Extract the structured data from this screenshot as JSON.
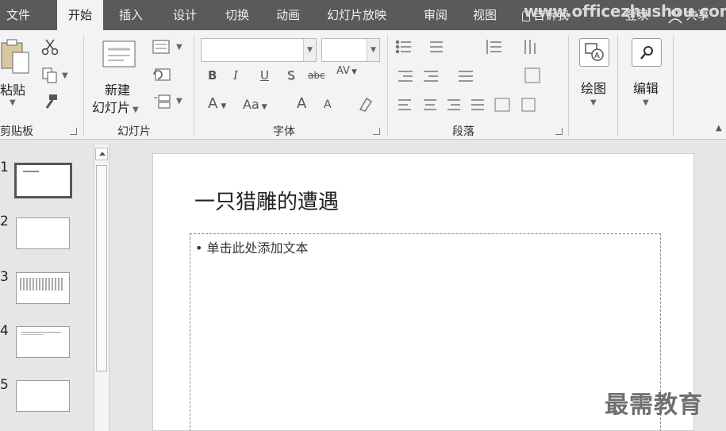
{
  "tabs": [
    {
      "label": "文件",
      "active": false
    },
    {
      "label": "开始",
      "active": true
    },
    {
      "label": "插入",
      "active": false
    },
    {
      "label": "设计",
      "active": false
    },
    {
      "label": "切换",
      "active": false
    },
    {
      "label": "动画",
      "active": false
    },
    {
      "label": "幻灯片放映",
      "active": false
    },
    {
      "label": "审阅",
      "active": false
    },
    {
      "label": "视图",
      "active": false
    },
    {
      "label": "告诉我",
      "active": false
    },
    {
      "label": "登录",
      "active": false
    },
    {
      "label": "共享",
      "active": false
    }
  ],
  "watermark_url": "www.officezhushou.com",
  "ribbon": {
    "clipboard": {
      "paste": "粘贴",
      "label": "剪贴板"
    },
    "slides": {
      "new_line1": "新建",
      "new_line2": "幻灯片",
      "label": "幻灯片"
    },
    "font": {
      "font_name": "",
      "font_size": "",
      "bold": "B",
      "italic": "I",
      "underline": "U",
      "shadow": "S",
      "strike": "abc",
      "spacing": "AV",
      "color": "A",
      "case": "Aa",
      "grow": "A",
      "shrink": "A",
      "label": "字体"
    },
    "paragraph": {
      "label": "段落"
    },
    "drawing": {
      "label": "绘图"
    },
    "editing": {
      "label": "编辑"
    }
  },
  "thumbnails": [
    {
      "num": "1",
      "selected": true
    },
    {
      "num": "2",
      "selected": false
    },
    {
      "num": "3",
      "selected": false
    },
    {
      "num": "4",
      "selected": false
    },
    {
      "num": "5",
      "selected": false
    }
  ],
  "slide": {
    "title": "一只猎雕的遭遇",
    "placeholder": "• 单击此处添加文本"
  },
  "watermark_bottom": "最需教育"
}
